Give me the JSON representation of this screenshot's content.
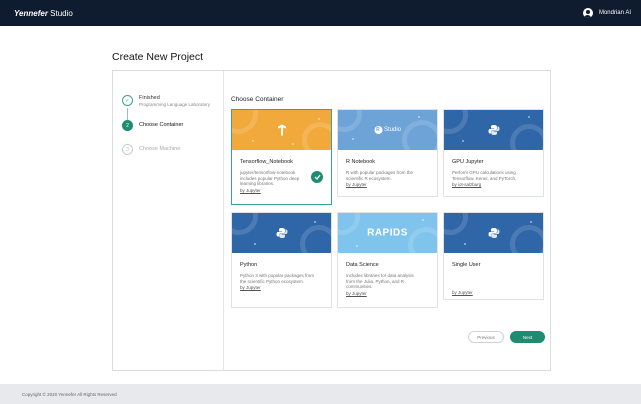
{
  "app": {
    "logo_brand": "Yennefer",
    "logo_product": "Studio"
  },
  "user": {
    "name": "Mondrian AI",
    "icon": "account-circle-icon"
  },
  "page": {
    "title": "Create New Project"
  },
  "steps": [
    {
      "title": "Finished",
      "subtitle": "Programming Language Laboratory",
      "status": "done",
      "marker": "✓"
    },
    {
      "title": "Choose Container",
      "subtitle": "",
      "status": "active",
      "marker": "2"
    },
    {
      "title": "Choose Machine",
      "subtitle": "",
      "status": "pending",
      "marker": "3"
    }
  ],
  "containers": {
    "section_title": "Choose Container",
    "cards": [
      {
        "name": "Tensorflow_Notebook",
        "description": "jupyter/tensorflow-notebook includes popular Python deep learning libraries.",
        "author": "by Jupyter",
        "banner_color": "#f2a93b",
        "icon": "tensorflow-icon",
        "selected": true
      },
      {
        "name": "R Notebook",
        "description": "R with popular packages from the scientific R ecosystem.",
        "author": "by Jupyter",
        "banner_color": "#6ea3d8",
        "icon": "rstudio-icon",
        "icon_label": "Studio",
        "selected": false
      },
      {
        "name": "GPU Jupyter",
        "description": "Perform GPU calculations using Tensorflow, Keras, and PyTorch.",
        "author": "by iot-salzburg",
        "banner_color": "#2f66a8",
        "icon": "python-icon",
        "selected": false
      },
      {
        "name": "Python",
        "description": "Python 3 with popular packages from the scientific Python ecosystem.",
        "author": "by Jupyter",
        "banner_color": "#2f66a8",
        "icon": "python-icon",
        "selected": false
      },
      {
        "name": "Data Science",
        "description": "Includes libraries for data analysis from the Julia, Python, and R communities.",
        "author": "by Jupyter",
        "banner_color": "#7fc4ec",
        "icon": "rapids-logo",
        "icon_label": "RAPIDS",
        "selected": false
      },
      {
        "name": "Single User",
        "description": "",
        "author": "by Jupyter",
        "banner_color": "#2f66a8",
        "icon": "python-icon",
        "selected": false
      }
    ]
  },
  "buttons": {
    "previous": "Previous",
    "next": "Next"
  },
  "footer": {
    "copyright": "Copyright © 2020 Yennefer All Rights Reserved"
  },
  "colors": {
    "topbar": "#0f1b2e",
    "accent": "#1e8c70"
  }
}
